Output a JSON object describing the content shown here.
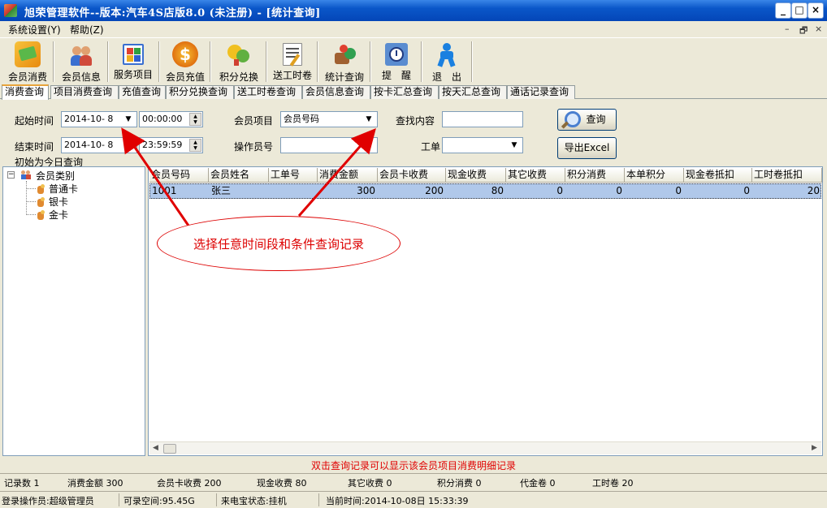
{
  "window": {
    "title": "旭荣管理软件--版本:汽车4S店版8.0 (未注册) - [统计查询]",
    "buttons": {
      "minimize": "_",
      "maximize": "□",
      "close": "×"
    }
  },
  "menu": {
    "items": [
      "系统设置(Y)",
      "帮助(Z)"
    ],
    "mdi_controls": {
      "minimize": "–",
      "restore": "🗗",
      "close": "×"
    }
  },
  "toolbar": {
    "items": [
      {
        "label": "会员消费",
        "icon": "member-consume-icon"
      },
      {
        "label": "会员信息",
        "icon": "member-info-icon"
      },
      {
        "label": "服务项目",
        "icon": "service-item-icon"
      },
      {
        "label": "会员充值",
        "icon": "recharge-coin-icon"
      },
      {
        "label": "积分兑换",
        "icon": "points-exchange-icon"
      },
      {
        "label": "送工时卷",
        "icon": "work-voucher-icon"
      },
      {
        "label": "统计查询",
        "icon": "statistics-icon"
      },
      {
        "label": "提　醒",
        "icon": "reminder-icon"
      },
      {
        "label": "退　出",
        "icon": "exit-icon"
      }
    ]
  },
  "tabs": [
    "消费查询",
    "项目消费查询",
    "充值查询",
    "积分兑换查询",
    "送工时卷查询",
    "会员信息查询",
    "按卡汇总查询",
    "按天汇总查询",
    "通话记录查询"
  ],
  "query": {
    "start_label": "起始时间",
    "start_date": "2014-10- 8",
    "start_time": "00:00:00",
    "end_label": "结束时间",
    "end_date": "2014-10- 8",
    "end_time": "23:59:59",
    "note": "初始为今日查询",
    "member_item_label": "会员项目",
    "member_item_value": "会员号码",
    "operator_label": "操作员号",
    "operator_value": "",
    "search_label": "查找内容",
    "search_value": "",
    "work_order_label": "工单",
    "work_order_value": "",
    "query_button": "查询",
    "export_button": "导出Excel"
  },
  "tree": {
    "root": "会员类别",
    "children": [
      "普通卡",
      "银卡",
      "金卡"
    ]
  },
  "grid": {
    "columns": [
      "会员号码",
      "会员姓名",
      "工单号",
      "消费金额",
      "会员卡收费",
      "现金收费",
      "其它收费",
      "积分消费",
      "本单积分",
      "现金卷抵扣",
      "工时卷抵扣"
    ],
    "rows": [
      [
        "1001",
        "张三",
        "",
        "300",
        "200",
        "80",
        "0",
        "0",
        "0",
        "0",
        "20"
      ]
    ]
  },
  "hint": "双击查询记录可以显示该会员项目消费明细记录",
  "summary": {
    "record_count": "记录数 1",
    "consume_amount": "消费金额 300",
    "card_fee": "会员卡收费 200",
    "cash_fee": "现金收费 80",
    "other_fee": "其它收费 0",
    "points_consume": "积分消费 0",
    "voucher": "代金卷 0",
    "work_voucher": "工时卷 20"
  },
  "status": {
    "operator": "登录操作员:超级管理员",
    "space": "可录空间:95.45G",
    "caller_status": "来电宝状态:挂机",
    "current_time": "当前时间:2014-10-08日 15:33:39"
  },
  "annotation": "选择任意时间段和条件查询记录",
  "colors": {
    "title_bar": "#0a56c8",
    "hint": "#e00000",
    "annotation": "#d00000",
    "selected_row": "#b0c8ea"
  }
}
